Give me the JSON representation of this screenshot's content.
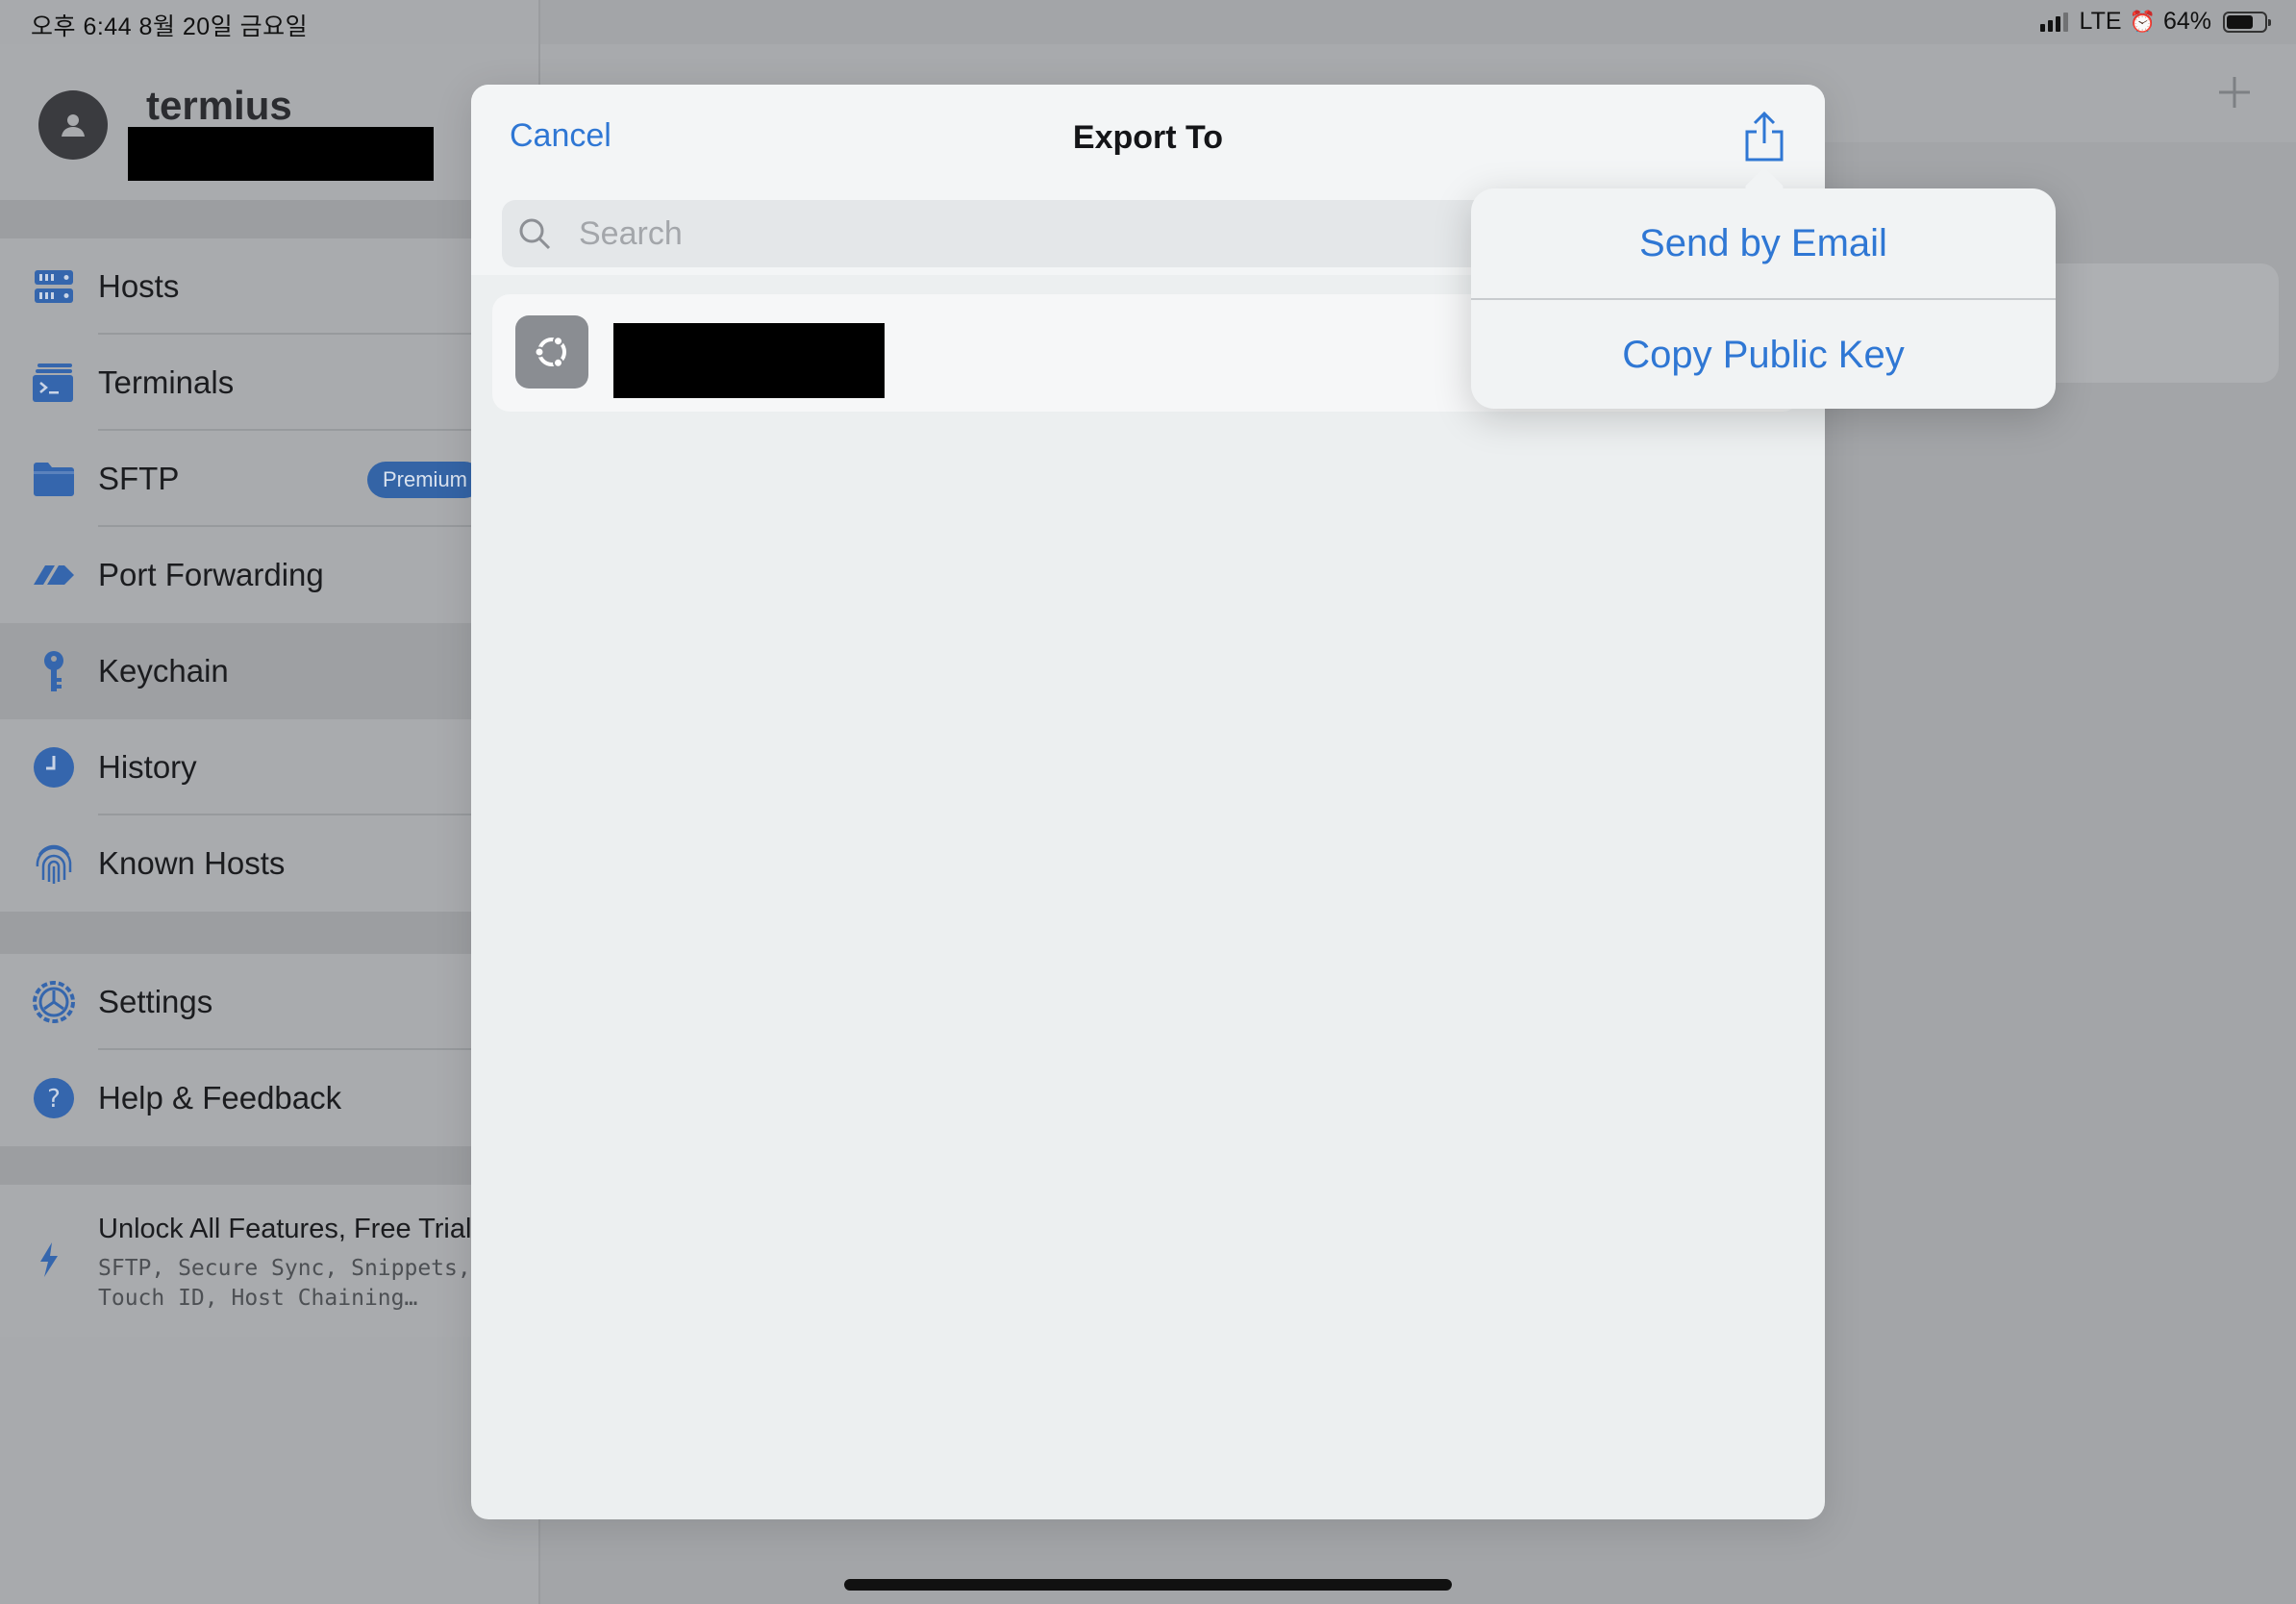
{
  "status_bar": {
    "time_date": "오후 6:44   8월 20일 금요일",
    "network": "LTE",
    "battery": "64%",
    "battery_level": 0.64
  },
  "sidebar": {
    "brand": "termius",
    "items": [
      {
        "label": "Hosts",
        "icon": "hosts-icon"
      },
      {
        "label": "Terminals",
        "icon": "terminal-icon"
      },
      {
        "label": "SFTP",
        "icon": "folder-icon",
        "badge": "Premium"
      },
      {
        "label": "Port Forwarding",
        "icon": "port-forward-icon"
      },
      {
        "label": "Keychain",
        "icon": "key-icon",
        "selected": true
      },
      {
        "label": "History",
        "icon": "clock-icon"
      },
      {
        "label": "Known Hosts",
        "icon": "fingerprint-icon"
      }
    ],
    "secondary_items": [
      {
        "label": "Settings",
        "icon": "gear-icon"
      },
      {
        "label": "Help & Feedback",
        "icon": "help-icon"
      }
    ],
    "promo": {
      "title": "Unlock All Features, Free Trial",
      "subtitle": "SFTP, Secure Sync, Snippets,\nTouch ID, Host Chaining…"
    }
  },
  "sheet": {
    "cancel": "Cancel",
    "title": "Export To",
    "search_placeholder": "Search"
  },
  "popover": {
    "items": [
      "Send by Email",
      "Copy Public Key"
    ]
  },
  "colors": {
    "accent": "#2f77d4",
    "premium_badge": "#3464a6"
  }
}
